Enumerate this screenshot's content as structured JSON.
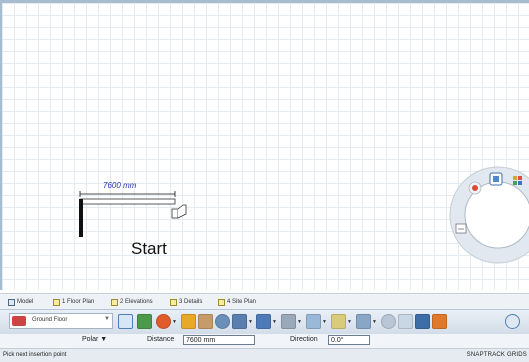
{
  "drawing": {
    "dimension_text": "7600 mm",
    "start_label": "Start"
  },
  "view_tabs": [
    {
      "label": "Model",
      "icon": "model-view-icon"
    },
    {
      "label": "1 Floor Plan",
      "icon": "sheet-icon"
    },
    {
      "label": "2 Elevations",
      "icon": "sheet-icon"
    },
    {
      "label": "3 Details",
      "icon": "sheet-icon"
    },
    {
      "label": "4 Site Plan",
      "icon": "sheet-icon"
    }
  ],
  "toolbar": {
    "floor_selector": "Ground Floor"
  },
  "input_bar": {
    "mode": "Polar ▼",
    "distance_label": "Distance",
    "distance_value": "7600 mm",
    "direction_label": "Direction",
    "direction_value": "0.0°"
  },
  "status": {
    "prompt": "Pick next insertion point",
    "snaps": "SNAPTRACK GRIDS"
  },
  "colors": {
    "dimension_text": "#2233aa",
    "canvas_grid": "#e4ebf1"
  }
}
